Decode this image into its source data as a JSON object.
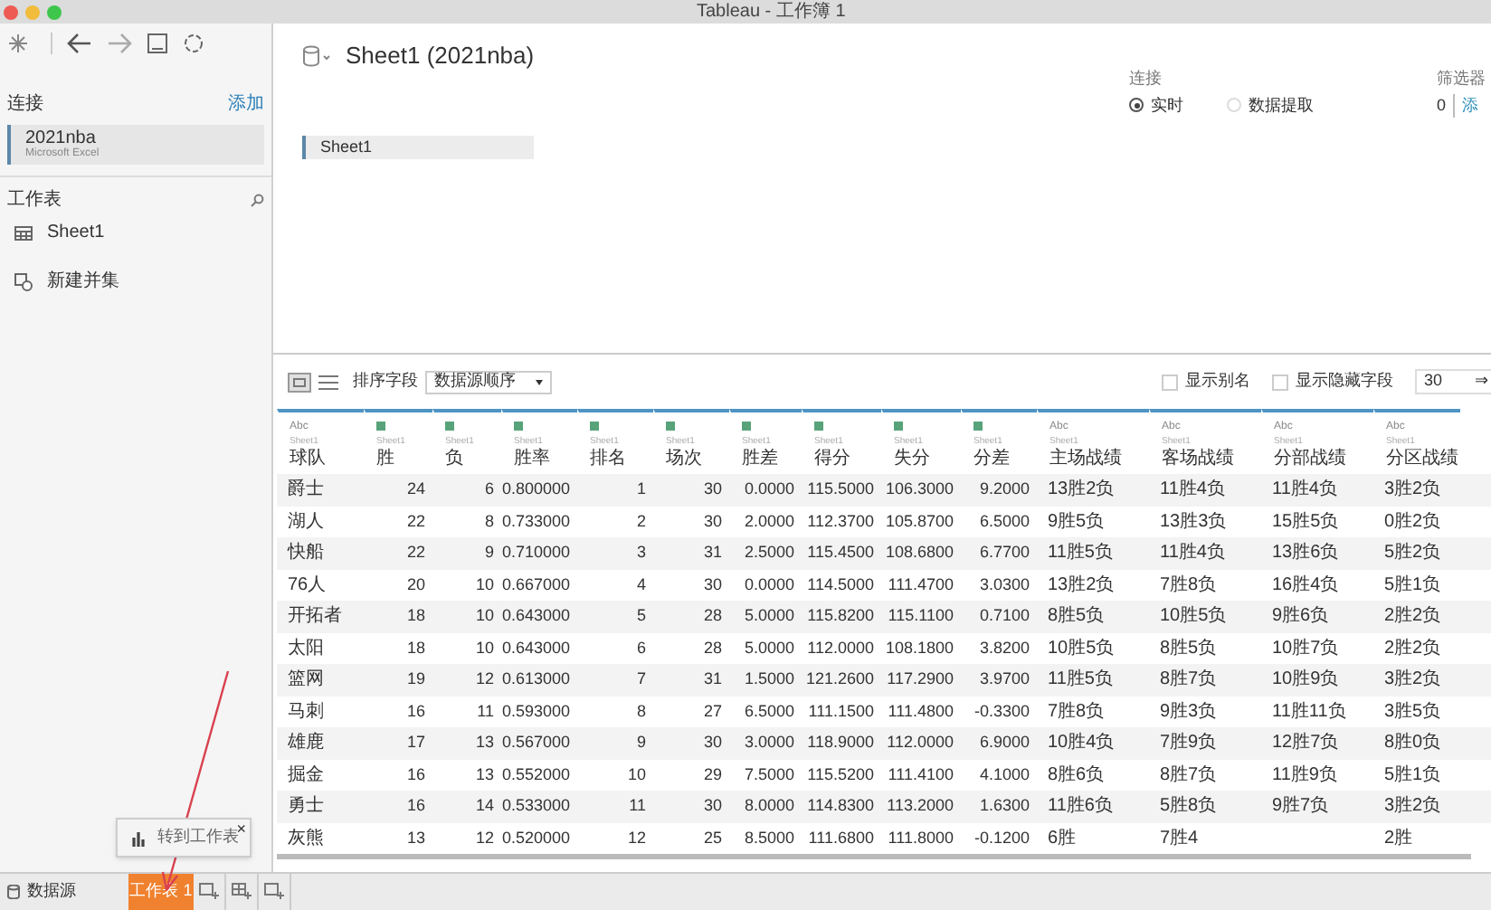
{
  "window": {
    "title": "Tableau - 工作簿 1"
  },
  "sidebar": {
    "connections_label": "连接",
    "add_link": "添加",
    "connection": {
      "name": "2021nba",
      "type": "Microsoft Excel"
    },
    "sheets_label": "工作表",
    "sheets": [
      "Sheet1"
    ],
    "new_union": "新建并集"
  },
  "datasource": {
    "title": "Sheet1 (2021nba)",
    "canvas_table": "Sheet1",
    "connection_label": "连接",
    "connection_options": [
      {
        "label": "实时",
        "selected": true
      },
      {
        "label": "数据提取",
        "selected": false
      }
    ],
    "filters_label": "筛选器",
    "filters_count": "0",
    "filters_add": "添"
  },
  "grid_toolbar": {
    "sort_label": "排序字段",
    "sort_value": "数据源顺序",
    "options": [
      {
        "label": "显示别名",
        "checked": false
      },
      {
        "label": "显示隐藏字段",
        "checked": false
      }
    ],
    "rows_value": "30",
    "rows_arrow": "⇒"
  },
  "table": {
    "columns": [
      {
        "name": "球队",
        "kind": "text",
        "type_label": "Abc",
        "source": "Sheet1"
      },
      {
        "name": "胜",
        "kind": "number",
        "source": "Sheet1"
      },
      {
        "name": "负",
        "kind": "number",
        "source": "Sheet1"
      },
      {
        "name": "胜率",
        "kind": "number",
        "source": "Sheet1"
      },
      {
        "name": "排名",
        "kind": "number",
        "source": "Sheet1"
      },
      {
        "name": "场次",
        "kind": "number",
        "source": "Sheet1"
      },
      {
        "name": "胜差",
        "kind": "number",
        "source": "Sheet1"
      },
      {
        "name": "得分",
        "kind": "number",
        "source": "Sheet1"
      },
      {
        "name": "失分",
        "kind": "number",
        "source": "Sheet1"
      },
      {
        "name": "分差",
        "kind": "number",
        "source": "Sheet1"
      },
      {
        "name": "主场战绩",
        "kind": "text",
        "type_label": "Abc",
        "source": "Sheet1"
      },
      {
        "name": "客场战绩",
        "kind": "text",
        "type_label": "Abc",
        "source": "Sheet1"
      },
      {
        "name": "分部战绩",
        "kind": "text",
        "type_label": "Abc",
        "source": "Sheet1"
      },
      {
        "name": "分区战绩",
        "kind": "text",
        "type_label": "Abc",
        "source": "Sheet1"
      }
    ],
    "rows": [
      [
        "爵士",
        "24",
        "6",
        "0.800000",
        "1",
        "30",
        "0.0000",
        "115.5000",
        "106.3000",
        "9.2000",
        "13胜2负",
        "11胜4负",
        "11胜4负",
        "3胜2负"
      ],
      [
        "湖人",
        "22",
        "8",
        "0.733000",
        "2",
        "30",
        "2.0000",
        "112.3700",
        "105.8700",
        "6.5000",
        "9胜5负",
        "13胜3负",
        "15胜5负",
        "0胜2负"
      ],
      [
        "快船",
        "22",
        "9",
        "0.710000",
        "3",
        "31",
        "2.5000",
        "115.4500",
        "108.6800",
        "6.7700",
        "11胜5负",
        "11胜4负",
        "13胜6负",
        "5胜2负"
      ],
      [
        "76人",
        "20",
        "10",
        "0.667000",
        "4",
        "30",
        "0.0000",
        "114.5000",
        "111.4700",
        "3.0300",
        "13胜2负",
        "7胜8负",
        "16胜4负",
        "5胜1负"
      ],
      [
        "开拓者",
        "18",
        "10",
        "0.643000",
        "5",
        "28",
        "5.0000",
        "115.8200",
        "115.1100",
        "0.7100",
        "8胜5负",
        "10胜5负",
        "9胜6负",
        "2胜2负"
      ],
      [
        "太阳",
        "18",
        "10",
        "0.643000",
        "6",
        "28",
        "5.0000",
        "112.0000",
        "108.1800",
        "3.8200",
        "10胜5负",
        "8胜5负",
        "10胜7负",
        "2胜2负"
      ],
      [
        "篮网",
        "19",
        "12",
        "0.613000",
        "7",
        "31",
        "1.5000",
        "121.2600",
        "117.2900",
        "3.9700",
        "11胜5负",
        "8胜7负",
        "10胜9负",
        "3胜2负"
      ],
      [
        "马刺",
        "16",
        "11",
        "0.593000",
        "8",
        "27",
        "6.5000",
        "111.1500",
        "111.4800",
        "-0.3300",
        "7胜8负",
        "9胜3负",
        "11胜11负",
        "3胜5负"
      ],
      [
        "雄鹿",
        "17",
        "13",
        "0.567000",
        "9",
        "30",
        "3.0000",
        "118.9000",
        "112.0000",
        "6.9000",
        "10胜4负",
        "7胜9负",
        "12胜7负",
        "8胜0负"
      ],
      [
        "掘金",
        "16",
        "13",
        "0.552000",
        "10",
        "29",
        "7.5000",
        "115.5200",
        "111.4100",
        "4.1000",
        "8胜6负",
        "8胜7负",
        "11胜9负",
        "5胜1负"
      ],
      [
        "勇士",
        "16",
        "14",
        "0.533000",
        "11",
        "30",
        "8.0000",
        "114.8300",
        "113.2000",
        "1.6300",
        "11胜6负",
        "5胜8负",
        "9胜7负",
        "3胜2负"
      ],
      [
        "灰熊",
        "13",
        "12",
        "0.520000",
        "12",
        "25",
        "8.5000",
        "111.6800",
        "111.8000",
        "-0.1200",
        "6胜",
        "7胜4",
        null,
        "2胜"
      ]
    ]
  },
  "tooltip": {
    "text": "转到工作表",
    "close": "×"
  },
  "bottom_tabs": [
    {
      "kind": "datasource",
      "label": "数据源",
      "selected": false
    },
    {
      "kind": "sheet",
      "label": "工作表 1",
      "selected": true
    },
    {
      "kind": "new-sheet"
    },
    {
      "kind": "new-dashboard"
    },
    {
      "kind": "new-story"
    }
  ]
}
